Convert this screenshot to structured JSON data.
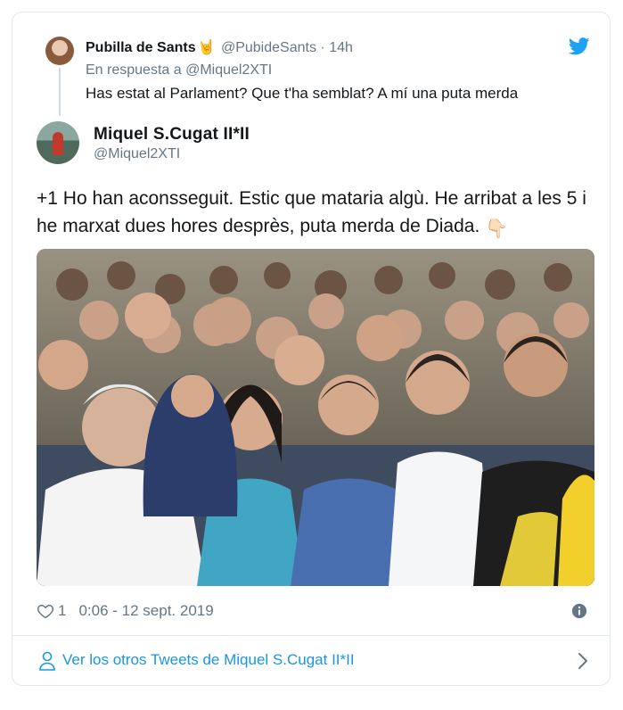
{
  "reply": {
    "name": "Pubilla de Sants",
    "emoji": "🤘",
    "handle": "@PubideSants",
    "separator": "·",
    "time": "14h",
    "in_reply_prefix": "En respuesta a",
    "in_reply_handle": "@Miquel2XTI",
    "text": "Has estat al Parlament? Que t'ha semblat? A mí una puta merda"
  },
  "tweet": {
    "name": "Miquel S.Cugat II*II",
    "handle": "@Miquel2XTI",
    "text": "+1 Ho han aconsseguit. Estic que mataria algù. He arribat a les 5 i he marxat dues hores desprès, puta merda de Diada.",
    "emoji": "👇🏻",
    "likes": "1",
    "timestamp": "0:06 - 12 sept. 2019"
  },
  "footer": {
    "more_tweets": "Ver los otros Tweets de Miquel S.Cugat II*II"
  },
  "colors": {
    "brand": "#1da1f2",
    "link": "#1b95e0",
    "muted": "#657786",
    "border": "#e1e8ed"
  },
  "icons": [
    "twitter-bird-icon",
    "heart-icon",
    "info-icon",
    "person-icon",
    "chevron-right-icon"
  ]
}
